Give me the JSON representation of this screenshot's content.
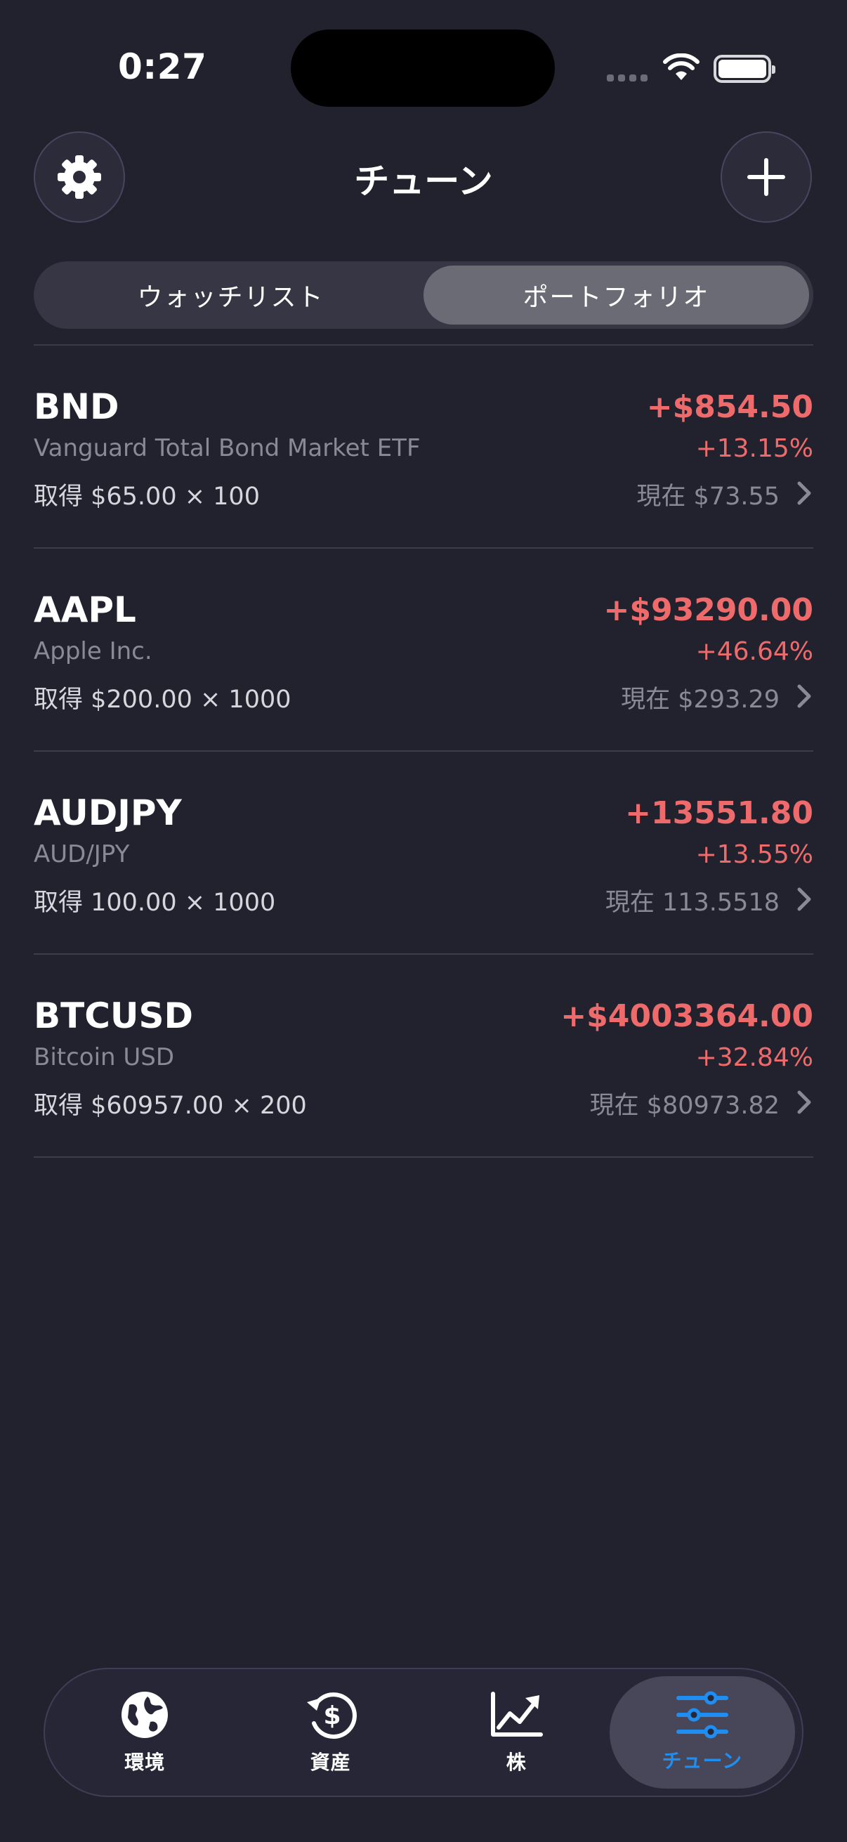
{
  "status_bar": {
    "time": "0:27"
  },
  "header": {
    "title": "チューン"
  },
  "segments": [
    {
      "label": "ウォッチリスト",
      "active": false
    },
    {
      "label": "ポートフォリオ",
      "active": true
    }
  ],
  "holdings": [
    {
      "symbol": "BND",
      "name": "Vanguard Total Bond Market ETF",
      "acquired": "取得 $65.00 × 100",
      "pnl": "+$854.50",
      "pct": "+13.15%",
      "current": "現在 $73.55"
    },
    {
      "symbol": "AAPL",
      "name": "Apple Inc.",
      "acquired": "取得 $200.00 × 1000",
      "pnl": "+$93290.00",
      "pct": "+46.64%",
      "current": "現在 $293.29"
    },
    {
      "symbol": "AUDJPY",
      "name": "AUD/JPY",
      "acquired": "取得 100.00 × 1000",
      "pnl": "+13551.80",
      "pct": "+13.55%",
      "current": "現在 113.5518"
    },
    {
      "symbol": "BTCUSD",
      "name": "Bitcoin USD",
      "acquired": "取得 $60957.00 × 200",
      "pnl": "+$4003364.00",
      "pct": "+32.84%",
      "current": "現在 $80973.82"
    }
  ],
  "tabs": [
    {
      "label": "環境",
      "icon": "globe-icon",
      "active": false
    },
    {
      "label": "資産",
      "icon": "dollar-cycle-icon",
      "active": false
    },
    {
      "label": "株",
      "icon": "chart-line-icon",
      "active": false
    },
    {
      "label": "チューン",
      "icon": "sliders-icon",
      "active": true
    }
  ],
  "colors": {
    "background": "#22222f",
    "gain": "#ef6b6b",
    "accent": "#1f8ef0"
  }
}
